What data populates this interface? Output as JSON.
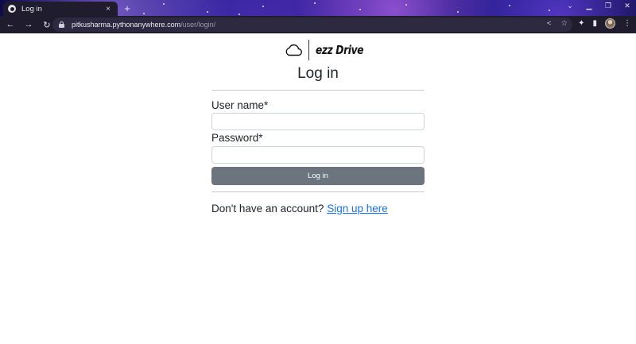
{
  "browser": {
    "tab_title": "Log in",
    "tab_close": "×",
    "new_tab": "+",
    "url_host": "pitkusharma.pythonanywhere.com",
    "url_path": "/user/login/",
    "icons": [
      "back-arrow-icon",
      "forward-arrow-icon",
      "reload-icon",
      "lock-icon",
      "share-icon",
      "star-icon",
      "extensions-icon",
      "side-panel-icon",
      "profile-avatar",
      "menu-icon"
    ],
    "window_controls": [
      "chevron-down",
      "minimize",
      "restore",
      "close"
    ]
  },
  "brand": {
    "logo_icon": "cloud-icon",
    "name": "ezz Drive"
  },
  "form": {
    "title": "Log in",
    "username_label": "User name*",
    "username_value": "",
    "password_label": "Password*",
    "password_value": "",
    "submit_label": "Log in"
  },
  "footer": {
    "prompt": "Don't have an account? ",
    "signup_link": "Sign up here"
  },
  "colors": {
    "button_bg": "#6c757d",
    "link": "#1a73e8",
    "text": "#212529"
  }
}
